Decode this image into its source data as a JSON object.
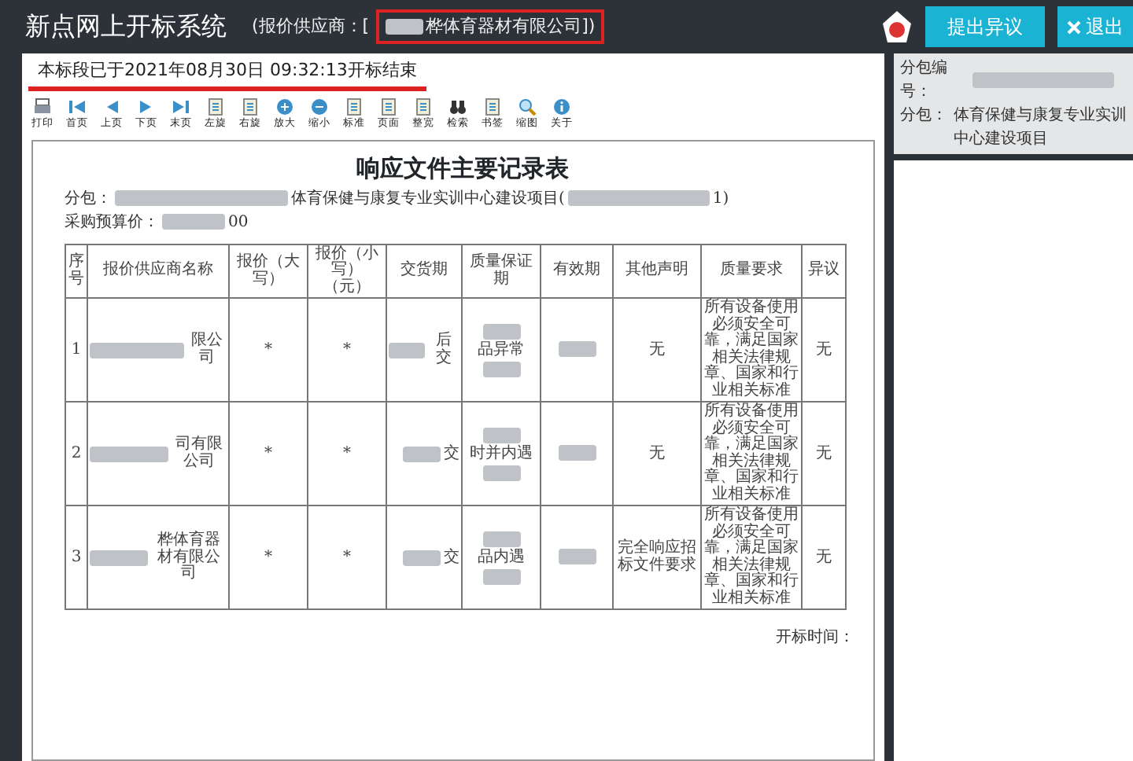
{
  "window": {
    "title": "新点网上开标系统",
    "supplier_prefix": "(报价供应商：[",
    "supplier_suffix": "桦体育器材有限公司])"
  },
  "header_buttons": [
    {
      "kind": "badge"
    },
    {
      "kind": "primary",
      "label": "提出异议"
    },
    {
      "kind": "close",
      "label": "退出"
    }
  ],
  "notice": "本标段已于2021年08月30日 09:32:13开标结束",
  "toolbar": [
    {
      "label": "打印"
    },
    {
      "label": "首页"
    },
    {
      "label": "上页"
    },
    {
      "label": "下页"
    },
    {
      "label": "末页"
    },
    {
      "label": "左旋"
    },
    {
      "label": "右旋"
    },
    {
      "label": "放大"
    },
    {
      "label": "缩小"
    },
    {
      "label": "标准"
    },
    {
      "label": "页面"
    },
    {
      "label": "整宽"
    },
    {
      "label": "检索"
    },
    {
      "label": "书签"
    },
    {
      "label": "缩图"
    },
    {
      "label": "关于"
    }
  ],
  "document": {
    "title": "响应文件主要记录表",
    "package_prefix": "分包：",
    "package_middle": "体育保健与康复专业实训中心建设项目(",
    "package_suffix": "1)",
    "budget_prefix": "采购预算价：",
    "budget_suffix": "00",
    "columns": [
      "序号",
      "报价供应商名称",
      "报价（大写）",
      "报价（小写）（元）",
      "交货期",
      "质量保证期",
      "有效期",
      "其他声明",
      "质量要求",
      "异议"
    ],
    "rows": [
      {
        "no": "1",
        "supplier": "限公司",
        "price_upper": "*",
        "price_lower": "*",
        "delivery": "后交",
        "warranty": "品异常",
        "other": "无",
        "quality": "所有设备使用必须安全可靠，满足国家相关法律规章、国家和行业相关标准",
        "objection": "无"
      },
      {
        "no": "2",
        "supplier": "司有限公司",
        "price_upper": "*",
        "price_lower": "*",
        "delivery": "交",
        "warranty": "时并内遇",
        "other": "无",
        "quality": "所有设备使用必须安全可靠，满足国家相关法律规章、国家和行业相关标准",
        "objection": "无"
      },
      {
        "no": "3",
        "supplier": "桦体育器材有限公司",
        "price_upper": "*",
        "price_lower": "*",
        "delivery": "交",
        "warranty": "品内遇",
        "other": "完全响应招标文件要求",
        "quality": "所有设备使用必须安全可靠，满足国家相关法律规章、国家和行业相关标准",
        "objection": "无"
      }
    ],
    "footer": "开标时间："
  },
  "side_panel": {
    "package_no_label": "分包编号：",
    "package_label": "分包：",
    "package_value": "体育保健与康复专业实训中心建设项目"
  }
}
